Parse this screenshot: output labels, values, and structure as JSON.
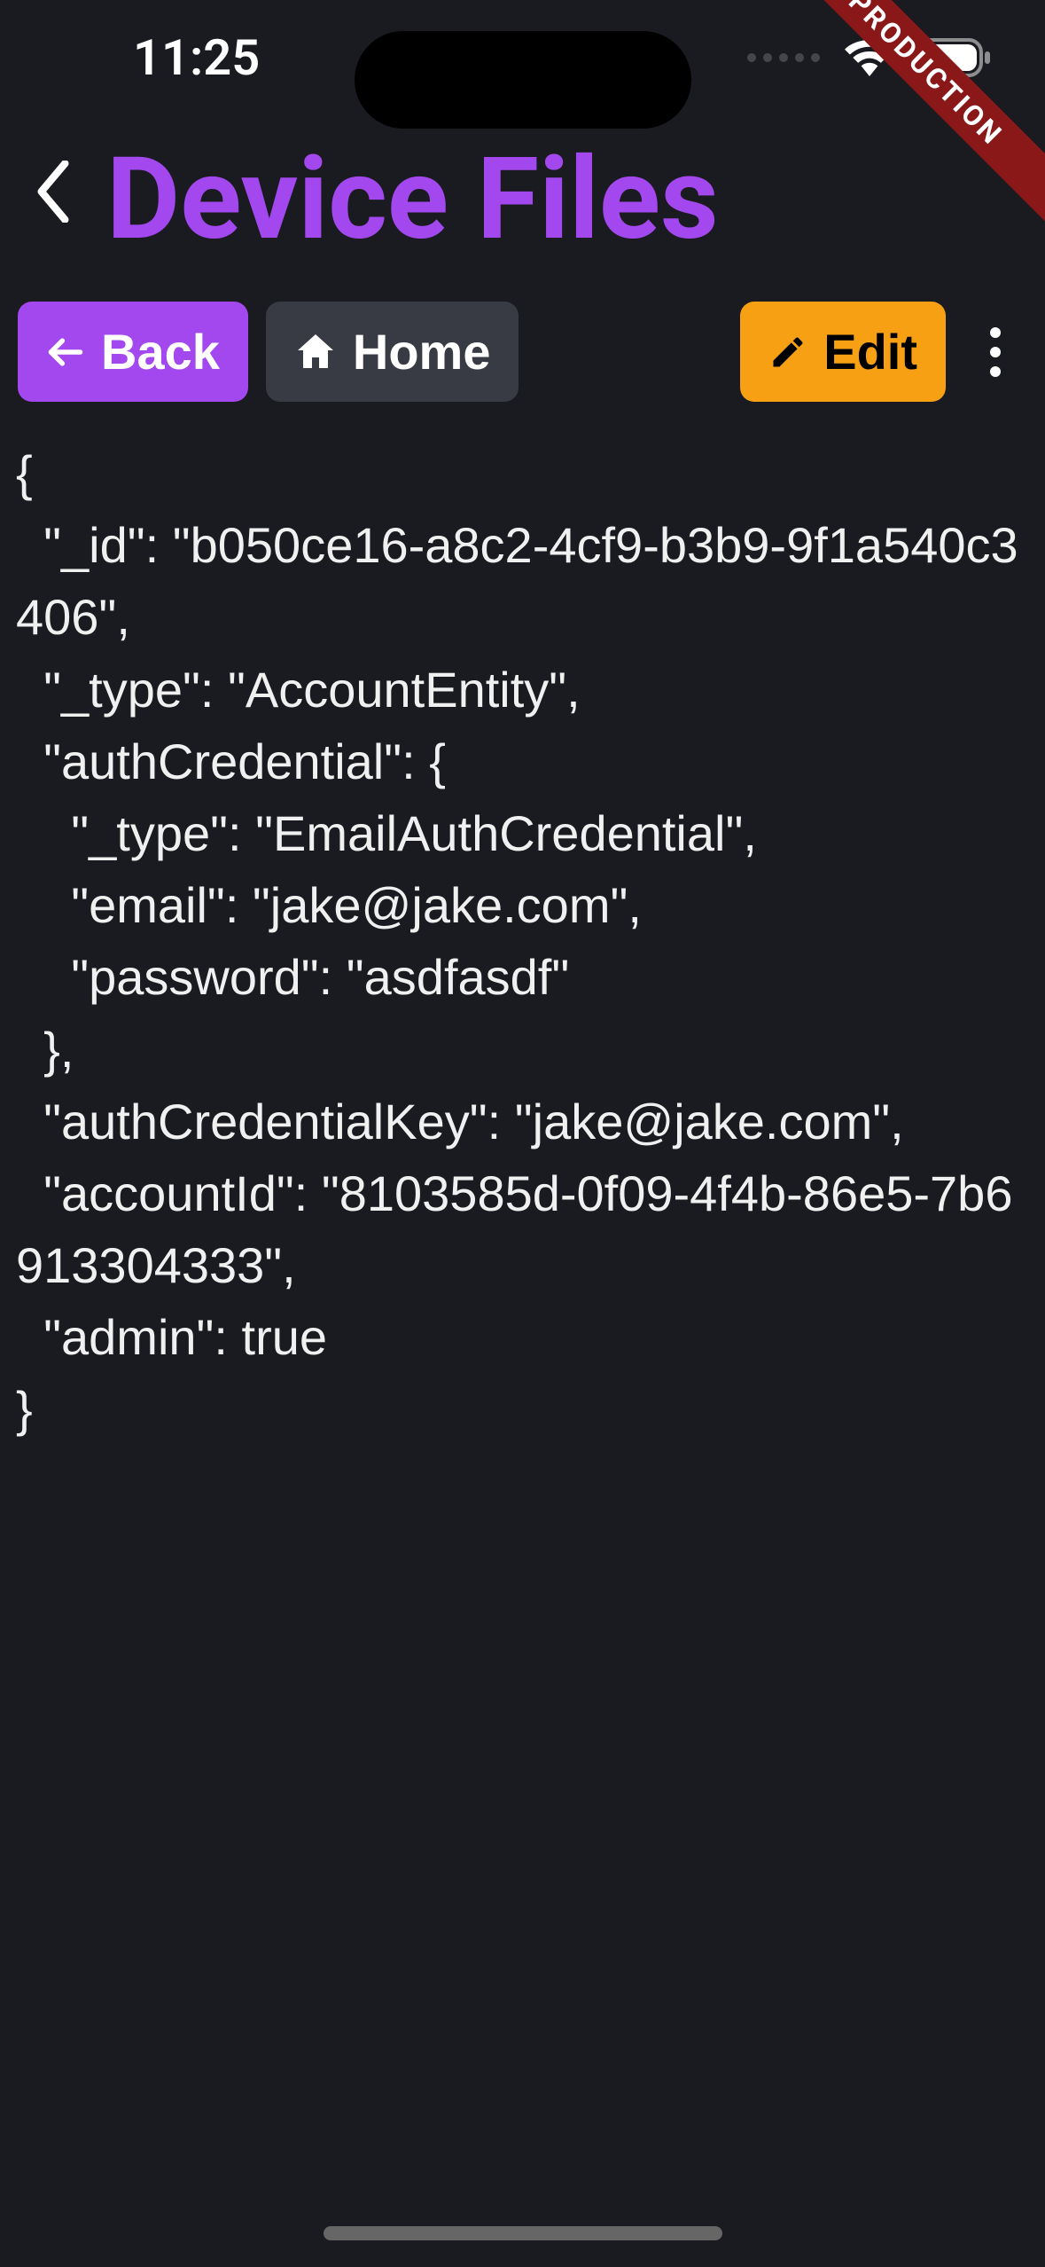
{
  "statusBar": {
    "time": "11:25"
  },
  "banner": {
    "label": "PRODUCTION"
  },
  "header": {
    "title": "Device Files"
  },
  "toolbar": {
    "back_label": "Back",
    "home_label": "Home",
    "edit_label": "Edit"
  },
  "jsonContent": "{\n  \"_id\": \"b050ce16-a8c2-4cf9-b3b9-9f1a540c3406\",\n  \"_type\": \"AccountEntity\",\n  \"authCredential\": {\n    \"_type\": \"EmailAuthCredential\",\n    \"email\": \"jake@jake.com\",\n    \"password\": \"asdfasdf\"\n  },\n  \"authCredentialKey\": \"jake@jake.com\",\n  \"accountId\": \"8103585d-0f09-4f4b-86e5-7b6913304333\",\n  \"admin\": true\n}"
}
